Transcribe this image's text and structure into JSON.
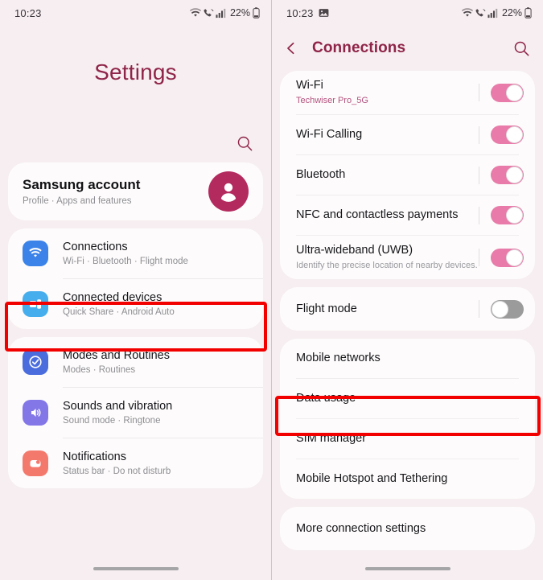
{
  "left": {
    "statusbar": {
      "time": "10:23",
      "battery_pct": "22%",
      "icons": [
        "wifi-icon",
        "wifi-calling-icon",
        "signal-bars-icon",
        "battery-icon"
      ]
    },
    "title": "Settings",
    "search_icon": "search-icon",
    "account": {
      "name": "Samsung account",
      "subtitle": "Profile  ·  Apps and features",
      "avatar_icon": "person-avatar-icon",
      "avatar_color": "#b32a5e"
    },
    "groups": [
      {
        "items": [
          {
            "title": "Connections",
            "subtitle": "Wi-Fi  ·  Bluetooth  ·  Flight mode",
            "icon": "wifi-icon",
            "icon_color": "#3b83e8",
            "highlighted": true
          },
          {
            "title": "Connected devices",
            "subtitle": "Quick Share  ·  Android Auto",
            "icon": "connected-devices-icon",
            "icon_color": "#47aeed",
            "highlighted": false
          }
        ]
      },
      {
        "items": [
          {
            "title": "Modes and Routines",
            "subtitle": "Modes  ·  Routines",
            "icon": "check-circle-icon",
            "icon_color": "#4a6cdd",
            "highlighted": false
          },
          {
            "title": "Sounds and vibration",
            "subtitle": "Sound mode  ·  Ringtone",
            "icon": "speaker-icon",
            "icon_color": "#8377e8",
            "highlighted": false
          },
          {
            "title": "Notifications",
            "subtitle": "Status bar  ·  Do not disturb",
            "icon": "notification-bubble-icon",
            "icon_color": "#f4796d",
            "highlighted": false
          }
        ]
      }
    ]
  },
  "right": {
    "statusbar": {
      "time": "10:23",
      "battery_pct": "22%",
      "notif_icon": "image-gallery-icon",
      "icons": [
        "wifi-icon",
        "wifi-calling-icon",
        "signal-bars-icon",
        "battery-icon"
      ]
    },
    "appbar": {
      "back_icon": "chevron-left-icon",
      "title": "Connections",
      "search_icon": "search-icon"
    },
    "groups": [
      {
        "items": [
          {
            "title": "Wi-Fi",
            "subtitle": "Techwiser Pro_5G",
            "sub_accent": true,
            "toggle": "on"
          },
          {
            "title": "Wi-Fi Calling",
            "subtitle": "",
            "toggle": "on"
          },
          {
            "title": "Bluetooth",
            "subtitle": "",
            "toggle": "on"
          },
          {
            "title": "NFC and contactless payments",
            "subtitle": "",
            "toggle": "on"
          },
          {
            "title": "Ultra-wideband (UWB)",
            "subtitle": "Identify the precise location of nearby devices.",
            "toggle": "on"
          }
        ]
      },
      {
        "items": [
          {
            "title": "Flight mode",
            "subtitle": "",
            "toggle": "off"
          }
        ]
      },
      {
        "items": [
          {
            "title": "Mobile networks",
            "subtitle": "",
            "toggle": "none"
          },
          {
            "title": "Data usage",
            "subtitle": "",
            "toggle": "none",
            "highlighted": true
          },
          {
            "title": "SIM manager",
            "subtitle": "",
            "toggle": "none"
          },
          {
            "title": "Mobile Hotspot and Tethering",
            "subtitle": "",
            "toggle": "none"
          }
        ]
      },
      {
        "items": [
          {
            "title": "More connection settings",
            "subtitle": "",
            "toggle": "none"
          }
        ]
      }
    ]
  },
  "highlight_color": "#f20000"
}
